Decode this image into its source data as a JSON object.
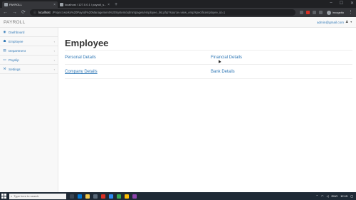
{
  "browser": {
    "tabs": [
      {
        "label": "PAYROLL",
        "active": true
      },
      {
        "label": "localhost / 127.0.0.1 / payroll_s...",
        "active": false
      }
    ],
    "new_tab": "+",
    "url_host": "localhost",
    "url_path": "/Project works%20Payroll%20Management%20System/admin/pages/employee_list.php?source=view_emp/specificemployee_id=1",
    "incognito_label": "Incognito"
  },
  "app": {
    "brand": "PAYROLL",
    "user_email": "admin@gmail.com"
  },
  "sidebar": {
    "items": [
      {
        "label": "Dashboard",
        "icon": "dashboard-icon",
        "glyph": "◉",
        "arrow": ""
      },
      {
        "label": "Employee",
        "icon": "users-icon",
        "glyph": "☗",
        "arrow": "‹"
      },
      {
        "label": "Department",
        "icon": "building-icon",
        "glyph": "▤",
        "arrow": "‹"
      },
      {
        "label": "Payslip",
        "icon": "payslip-icon",
        "glyph": "▭",
        "arrow": "‹"
      },
      {
        "label": "Settings",
        "icon": "settings-icon",
        "glyph": "⚒",
        "arrow": "‹"
      }
    ]
  },
  "main": {
    "title": "Employee",
    "links": {
      "personal": "Personal Details",
      "financial": "Financial Details",
      "company": "Company Details",
      "bank": "Bank Details"
    }
  },
  "taskbar": {
    "search_placeholder": "Type here to search",
    "lang": "ENG",
    "time": "12:15"
  },
  "colors": {
    "link": "#337ab7",
    "sidebar_bg": "#f8f8f8",
    "chrome_dark": "#202124"
  }
}
